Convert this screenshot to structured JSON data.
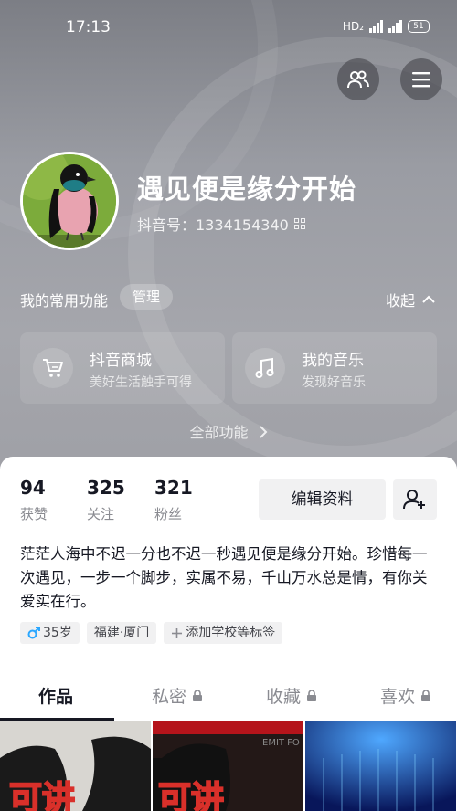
{
  "status_bar": {
    "time": "17:13",
    "hd_label": "HD₂",
    "net1": "⁴ᴳ",
    "net2": "⁴ᴳ",
    "battery": "51"
  },
  "header": {},
  "profile": {
    "name": "遇见便是缘分开始",
    "douyin_id": "抖音号：1334154340"
  },
  "functions": {
    "title": "我的常用功能",
    "manage": "管理",
    "collapse": "收起",
    "cards": [
      {
        "title": "抖音商城",
        "subtitle": "美好生活触手可得",
        "icon": "cart-icon"
      },
      {
        "title": "我的音乐",
        "subtitle": "发现好音乐",
        "icon": "music-note-icon"
      }
    ],
    "all": "全部功能"
  },
  "stats": [
    {
      "value": "94",
      "label": "获赞"
    },
    {
      "value": "325",
      "label": "关注"
    },
    {
      "value": "321",
      "label": "粉丝"
    }
  ],
  "edit_profile": "编辑资料",
  "bio": "茫茫人海中不迟一分也不迟一秒遇见便是缘分开始。珍惜每一次遇见，一步一个脚步，实属不易，千山万水总是情，有你关爱实在行。",
  "tags": [
    {
      "text": "35岁",
      "icon": "male-icon"
    },
    {
      "text": "福建·厦门"
    },
    {
      "text": "添加学校等标签",
      "icon": "plus-icon"
    }
  ],
  "tabs": [
    {
      "label": "作品",
      "active": true
    },
    {
      "label": "私密",
      "locked": true
    },
    {
      "label": "收藏",
      "locked": true
    },
    {
      "label": "喜欢",
      "locked": true
    }
  ],
  "thumbnails": [
    {
      "text": "可讲"
    },
    {
      "text": "可讲",
      "overlay": "EMIT FO"
    },
    {
      "text": ""
    }
  ],
  "colors": {
    "accent_male": "#2aa7ff",
    "text_primary": "#161823",
    "text_secondary": "#8a8b91"
  }
}
